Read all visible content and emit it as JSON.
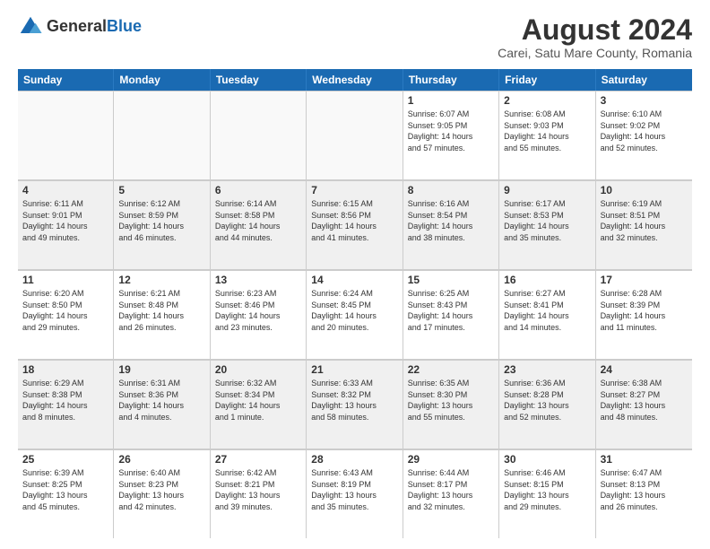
{
  "header": {
    "logo_general": "General",
    "logo_blue": "Blue",
    "title": "August 2024",
    "subtitle": "Carei, Satu Mare County, Romania"
  },
  "calendar": {
    "days_of_week": [
      "Sunday",
      "Monday",
      "Tuesday",
      "Wednesday",
      "Thursday",
      "Friday",
      "Saturday"
    ],
    "weeks": [
      [
        {
          "day": "",
          "info": "",
          "empty": true
        },
        {
          "day": "",
          "info": "",
          "empty": true
        },
        {
          "day": "",
          "info": "",
          "empty": true
        },
        {
          "day": "",
          "info": "",
          "empty": true
        },
        {
          "day": "1",
          "info": "Sunrise: 6:07 AM\nSunset: 9:05 PM\nDaylight: 14 hours\nand 57 minutes."
        },
        {
          "day": "2",
          "info": "Sunrise: 6:08 AM\nSunset: 9:03 PM\nDaylight: 14 hours\nand 55 minutes."
        },
        {
          "day": "3",
          "info": "Sunrise: 6:10 AM\nSunset: 9:02 PM\nDaylight: 14 hours\nand 52 minutes."
        }
      ],
      [
        {
          "day": "4",
          "info": "Sunrise: 6:11 AM\nSunset: 9:01 PM\nDaylight: 14 hours\nand 49 minutes."
        },
        {
          "day": "5",
          "info": "Sunrise: 6:12 AM\nSunset: 8:59 PM\nDaylight: 14 hours\nand 46 minutes."
        },
        {
          "day": "6",
          "info": "Sunrise: 6:14 AM\nSunset: 8:58 PM\nDaylight: 14 hours\nand 44 minutes."
        },
        {
          "day": "7",
          "info": "Sunrise: 6:15 AM\nSunset: 8:56 PM\nDaylight: 14 hours\nand 41 minutes."
        },
        {
          "day": "8",
          "info": "Sunrise: 6:16 AM\nSunset: 8:54 PM\nDaylight: 14 hours\nand 38 minutes."
        },
        {
          "day": "9",
          "info": "Sunrise: 6:17 AM\nSunset: 8:53 PM\nDaylight: 14 hours\nand 35 minutes."
        },
        {
          "day": "10",
          "info": "Sunrise: 6:19 AM\nSunset: 8:51 PM\nDaylight: 14 hours\nand 32 minutes."
        }
      ],
      [
        {
          "day": "11",
          "info": "Sunrise: 6:20 AM\nSunset: 8:50 PM\nDaylight: 14 hours\nand 29 minutes."
        },
        {
          "day": "12",
          "info": "Sunrise: 6:21 AM\nSunset: 8:48 PM\nDaylight: 14 hours\nand 26 minutes."
        },
        {
          "day": "13",
          "info": "Sunrise: 6:23 AM\nSunset: 8:46 PM\nDaylight: 14 hours\nand 23 minutes."
        },
        {
          "day": "14",
          "info": "Sunrise: 6:24 AM\nSunset: 8:45 PM\nDaylight: 14 hours\nand 20 minutes."
        },
        {
          "day": "15",
          "info": "Sunrise: 6:25 AM\nSunset: 8:43 PM\nDaylight: 14 hours\nand 17 minutes."
        },
        {
          "day": "16",
          "info": "Sunrise: 6:27 AM\nSunset: 8:41 PM\nDaylight: 14 hours\nand 14 minutes."
        },
        {
          "day": "17",
          "info": "Sunrise: 6:28 AM\nSunset: 8:39 PM\nDaylight: 14 hours\nand 11 minutes."
        }
      ],
      [
        {
          "day": "18",
          "info": "Sunrise: 6:29 AM\nSunset: 8:38 PM\nDaylight: 14 hours\nand 8 minutes."
        },
        {
          "day": "19",
          "info": "Sunrise: 6:31 AM\nSunset: 8:36 PM\nDaylight: 14 hours\nand 4 minutes."
        },
        {
          "day": "20",
          "info": "Sunrise: 6:32 AM\nSunset: 8:34 PM\nDaylight: 14 hours\nand 1 minute."
        },
        {
          "day": "21",
          "info": "Sunrise: 6:33 AM\nSunset: 8:32 PM\nDaylight: 13 hours\nand 58 minutes."
        },
        {
          "day": "22",
          "info": "Sunrise: 6:35 AM\nSunset: 8:30 PM\nDaylight: 13 hours\nand 55 minutes."
        },
        {
          "day": "23",
          "info": "Sunrise: 6:36 AM\nSunset: 8:28 PM\nDaylight: 13 hours\nand 52 minutes."
        },
        {
          "day": "24",
          "info": "Sunrise: 6:38 AM\nSunset: 8:27 PM\nDaylight: 13 hours\nand 48 minutes."
        }
      ],
      [
        {
          "day": "25",
          "info": "Sunrise: 6:39 AM\nSunset: 8:25 PM\nDaylight: 13 hours\nand 45 minutes."
        },
        {
          "day": "26",
          "info": "Sunrise: 6:40 AM\nSunset: 8:23 PM\nDaylight: 13 hours\nand 42 minutes."
        },
        {
          "day": "27",
          "info": "Sunrise: 6:42 AM\nSunset: 8:21 PM\nDaylight: 13 hours\nand 39 minutes."
        },
        {
          "day": "28",
          "info": "Sunrise: 6:43 AM\nSunset: 8:19 PM\nDaylight: 13 hours\nand 35 minutes."
        },
        {
          "day": "29",
          "info": "Sunrise: 6:44 AM\nSunset: 8:17 PM\nDaylight: 13 hours\nand 32 minutes."
        },
        {
          "day": "30",
          "info": "Sunrise: 6:46 AM\nSunset: 8:15 PM\nDaylight: 13 hours\nand 29 minutes."
        },
        {
          "day": "31",
          "info": "Sunrise: 6:47 AM\nSunset: 8:13 PM\nDaylight: 13 hours\nand 26 minutes."
        }
      ]
    ]
  }
}
